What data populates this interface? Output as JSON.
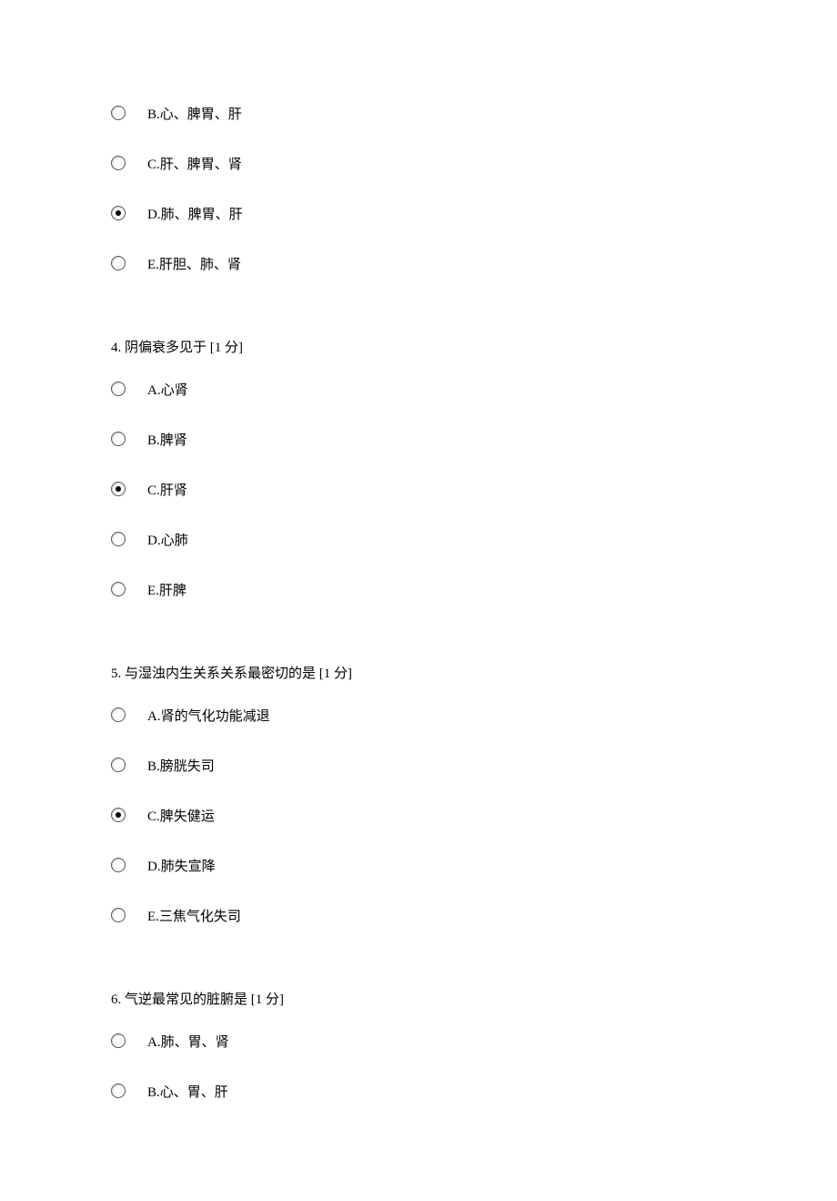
{
  "blocks": [
    {
      "type": "options",
      "name": "q3-tail-options",
      "options": [
        {
          "name": "q3-opt-b",
          "label": "B.心、脾胃、肝",
          "selected": false
        },
        {
          "name": "q3-opt-c",
          "label": "C.肝、脾胃、肾",
          "selected": false
        },
        {
          "name": "q3-opt-d",
          "label": "D.肺、脾胃、肝",
          "selected": true
        },
        {
          "name": "q3-opt-e",
          "label": "E.肝胆、肺、肾",
          "selected": false
        }
      ]
    },
    {
      "type": "question",
      "name": "q4",
      "text": "4. 阴偏衰多见于 [1 分]",
      "options": [
        {
          "name": "q4-opt-a",
          "label": "A.心肾",
          "selected": false
        },
        {
          "name": "q4-opt-b",
          "label": "B.脾肾",
          "selected": false
        },
        {
          "name": "q4-opt-c",
          "label": "C.肝肾",
          "selected": true
        },
        {
          "name": "q4-opt-d",
          "label": "D.心肺",
          "selected": false
        },
        {
          "name": "q4-opt-e",
          "label": "E.肝脾",
          "selected": false
        }
      ]
    },
    {
      "type": "question",
      "name": "q5",
      "text": "5. 与湿浊内生关系关系最密切的是 [1 分]",
      "options": [
        {
          "name": "q5-opt-a",
          "label": "A.肾的气化功能减退",
          "selected": false
        },
        {
          "name": "q5-opt-b",
          "label": "B.膀胱失司",
          "selected": false
        },
        {
          "name": "q5-opt-c",
          "label": "C.脾失健运",
          "selected": true
        },
        {
          "name": "q5-opt-d",
          "label": "D.肺失宣降",
          "selected": false
        },
        {
          "name": "q5-opt-e",
          "label": "E.三焦气化失司",
          "selected": false
        }
      ]
    },
    {
      "type": "question",
      "name": "q6",
      "text": "6. 气逆最常见的脏腑是 [1 分]",
      "options": [
        {
          "name": "q6-opt-a",
          "label": "A.肺、胃、肾",
          "selected": false
        },
        {
          "name": "q6-opt-b",
          "label": "B.心、胃、肝",
          "selected": false
        }
      ]
    }
  ]
}
